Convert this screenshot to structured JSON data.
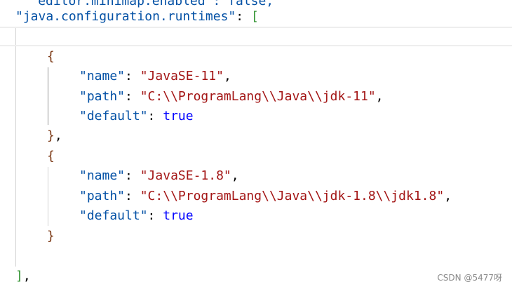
{
  "editor": {
    "lines": {
      "l0": "\"editor.minimap.enabled\": false,",
      "l1_key": "\"java.configuration.runtimes\"",
      "l1_colon": ": ",
      "l1_bracket": "[",
      "l3_brace": "{",
      "l4_key": "\"name\"",
      "l4_colon": ": ",
      "l4_val": "\"JavaSE-11\"",
      "l4_comma": ",",
      "l5_key": "\"path\"",
      "l5_colon": ": ",
      "l5_val": "\"C:\\\\ProgramLang\\\\Java\\\\jdk-11\"",
      "l5_comma": ",",
      "l6_key": "\"default\"",
      "l6_colon": ": ",
      "l6_val": "true",
      "l7_brace": "}",
      "l7_comma": ",",
      "l8_brace": "{",
      "l9_key": "\"name\"",
      "l9_colon": ": ",
      "l9_val": "\"JavaSE-1.8\"",
      "l9_comma": ",",
      "l10_key": "\"path\"",
      "l10_colon": ": ",
      "l10_val": "\"C:\\\\ProgramLang\\\\Java\\\\jdk-1.8\\\\jdk1.8\"",
      "l10_comma": ",",
      "l11_key": "\"default\"",
      "l11_colon": ": ",
      "l11_val": "true",
      "l12_brace": "}",
      "l14_bracket": "]",
      "l14_comma": ","
    },
    "colors": {
      "key": "#0451a5",
      "string": "#a31515",
      "boolean": "#0000ff",
      "brace": "#7b3814",
      "bracket": "#319331"
    }
  },
  "watermark": {
    "text": "CSDN @5477呀"
  }
}
